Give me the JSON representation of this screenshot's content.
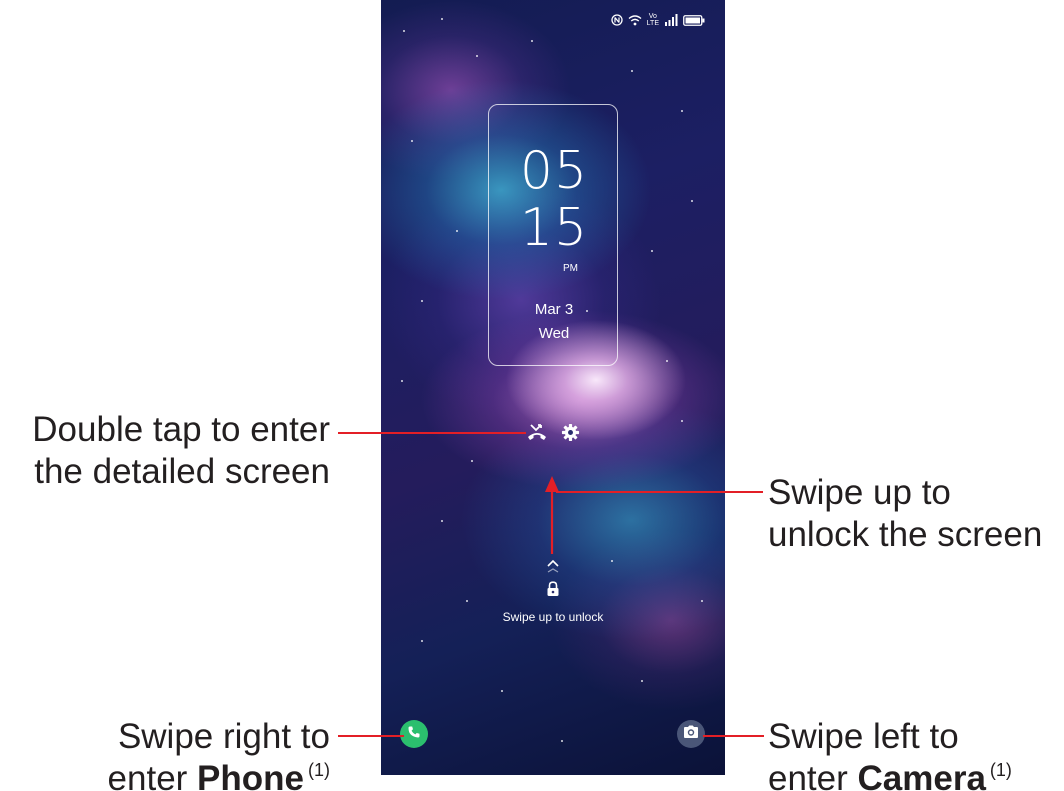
{
  "status_bar": {
    "icons": [
      "nfc-icon",
      "wifi-icon",
      "volte-icon",
      "signal-icon",
      "battery-icon"
    ],
    "volte_label_top": "Vo",
    "volte_label_bottom": "LTE"
  },
  "lock_screen": {
    "clock_hour": "05",
    "clock_minute": "15",
    "clock_ampm": "PM",
    "date": "Mar 3",
    "day": "Wed",
    "notification_icons": [
      "missed-call-icon",
      "settings-icon"
    ],
    "swipe_hint": "Swipe up to unlock",
    "lock_icon": "lock-icon",
    "chevron_icon": "chevron-up-icon"
  },
  "shortcuts": {
    "left": {
      "icon": "phone-icon",
      "color": "#2bbf6e"
    },
    "right": {
      "icon": "camera-icon",
      "color": "#4a5678"
    }
  },
  "annotations": {
    "double_tap": {
      "line1": "Double tap to enter",
      "line2": "the detailed screen"
    },
    "swipe_up": {
      "line1": "Swipe up to",
      "line2": "unlock the screen"
    },
    "swipe_right": {
      "line1": "Swipe right to",
      "line2_prefix": "enter ",
      "line2_bold": "Phone",
      "footnote": "(1)"
    },
    "swipe_left": {
      "line1": "Swipe left to",
      "line2_prefix": "enter ",
      "line2_bold": "Camera",
      "footnote": "(1)"
    }
  },
  "colors": {
    "callout": "#e31f26",
    "annotation_text": "#231f20"
  }
}
